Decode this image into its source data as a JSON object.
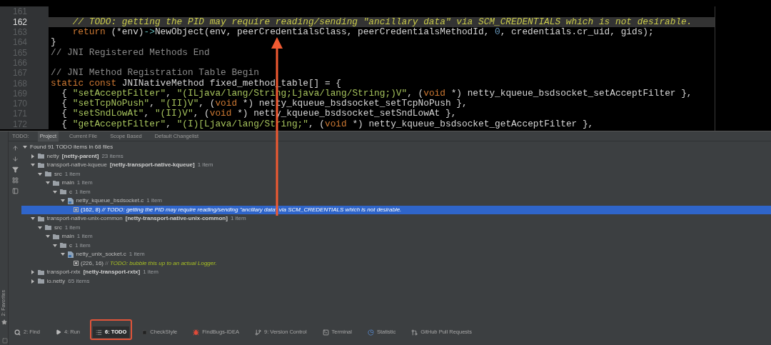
{
  "editor": {
    "lines": [
      {
        "number": "161",
        "current": false
      },
      {
        "number": "162",
        "current": true,
        "indented": true,
        "segments": [
          {
            "kind": "todo",
            "text": "// TODO: getting the PID may require reading/sending \"ancillary data\" via SCM_CREDENTIALS which is not desirable."
          }
        ]
      },
      {
        "number": "163",
        "current": false,
        "indented": true,
        "segments": [
          {
            "kind": "keyword",
            "text": "return"
          },
          {
            "kind": "plain",
            "text": " (*env)"
          },
          {
            "kind": "operator",
            "text": "->"
          },
          {
            "kind": "plain",
            "text": "NewObject(env, peerCredentialsClass, peerCredentialsMethodId, "
          },
          {
            "kind": "number",
            "text": "0"
          },
          {
            "kind": "plain",
            "text": ", credentials.cr_uid, gids);"
          }
        ]
      },
      {
        "number": "164",
        "current": false,
        "segments": [
          {
            "kind": "plain",
            "text": "}"
          }
        ]
      },
      {
        "number": "165",
        "current": false,
        "segments": [
          {
            "kind": "comment",
            "text": "// JNI Registered Methods End"
          }
        ]
      },
      {
        "number": "166",
        "current": false
      },
      {
        "number": "167",
        "current": false,
        "segments": [
          {
            "kind": "comment",
            "text": "// JNI Method Registration Table Begin"
          }
        ]
      },
      {
        "number": "168",
        "current": false,
        "segments": [
          {
            "kind": "keyword",
            "text": "static const"
          },
          {
            "kind": "plain",
            "text": " JNINativeMethod fixed_method_table[] = {"
          }
        ]
      },
      {
        "number": "169",
        "current": false,
        "segments": [
          {
            "kind": "plain",
            "text": "  { "
          },
          {
            "kind": "string",
            "text": "\"setAcceptFilter\""
          },
          {
            "kind": "plain",
            "text": ", "
          },
          {
            "kind": "string",
            "text": "\"(ILjava/lang/String;Ljava/lang/String;)V\""
          },
          {
            "kind": "plain",
            "text": ", ("
          },
          {
            "kind": "keyword",
            "text": "void"
          },
          {
            "kind": "plain",
            "text": " *) netty_kqueue_bsdsocket_setAcceptFilter },"
          }
        ]
      },
      {
        "number": "170",
        "current": false,
        "segments": [
          {
            "kind": "plain",
            "text": "  { "
          },
          {
            "kind": "string",
            "text": "\"setTcpNoPush\""
          },
          {
            "kind": "plain",
            "text": ", "
          },
          {
            "kind": "string",
            "text": "\"(II)V\""
          },
          {
            "kind": "plain",
            "text": ", ("
          },
          {
            "kind": "keyword",
            "text": "void"
          },
          {
            "kind": "plain",
            "text": " *) netty_kqueue_bsdsocket_setTcpNoPush },"
          }
        ]
      },
      {
        "number": "171",
        "current": false,
        "segments": [
          {
            "kind": "plain",
            "text": "  { "
          },
          {
            "kind": "string",
            "text": "\"setSndLowAt\""
          },
          {
            "kind": "plain",
            "text": ", "
          },
          {
            "kind": "string",
            "text": "\"(II)V\""
          },
          {
            "kind": "plain",
            "text": ", ("
          },
          {
            "kind": "keyword",
            "text": "void"
          },
          {
            "kind": "plain",
            "text": " *) netty_kqueue_bsdsocket_setSndLowAt },"
          }
        ]
      },
      {
        "number": "172",
        "current": false,
        "segments": [
          {
            "kind": "plain",
            "text": "  { "
          },
          {
            "kind": "string",
            "text": "\"getAcceptFilter\""
          },
          {
            "kind": "plain",
            "text": ", "
          },
          {
            "kind": "string",
            "text": "\"(I)[Ljava/lang/String;\""
          },
          {
            "kind": "plain",
            "text": ", ("
          },
          {
            "kind": "keyword",
            "text": "void"
          },
          {
            "kind": "plain",
            "text": " *) netty_kqueue_bsdsocket_getAcceptFilter },"
          }
        ]
      }
    ]
  },
  "todo_panel": {
    "label": "TODO:",
    "tabs": [
      {
        "label": "Project",
        "selected": true
      },
      {
        "label": "Current File",
        "selected": false
      },
      {
        "label": "Scope Based",
        "selected": false
      },
      {
        "label": "Default Changelist",
        "selected": false
      }
    ],
    "tree": [
      {
        "kind": "root",
        "name": "Found 91 TODO items in 68 files",
        "expanded": true,
        "children": [
          {
            "kind": "folder",
            "name": "netty",
            "module": "[netty-parent]",
            "count": "23 items",
            "expanded": false
          },
          {
            "kind": "folder",
            "name": "transport-native-kqueue",
            "module": "[netty-transport-native-kqueue]",
            "count": "1 item",
            "expanded": true,
            "children": [
              {
                "kind": "folder",
                "name": "src",
                "count": "1 item",
                "expanded": true,
                "children": [
                  {
                    "kind": "folder",
                    "name": "main",
                    "count": "1 item",
                    "expanded": true,
                    "children": [
                      {
                        "kind": "folder",
                        "name": "c",
                        "count": "1 item",
                        "expanded": true,
                        "children": [
                          {
                            "kind": "file",
                            "name": "netty_kqueue_bsdsocket.c",
                            "count": "1 item",
                            "expanded": true,
                            "children": [
                              {
                                "kind": "todo",
                                "location": "(162, 8)",
                                "prefix": "//",
                                "text": "TODO: getting the PID may require reading/sending \"ancillary data\" via SCM_CREDENTIALS which is not desirable.",
                                "selected": true
                              }
                            ]
                          }
                        ]
                      }
                    ]
                  }
                ]
              }
            ]
          },
          {
            "kind": "folder",
            "name": "transport-native-unix-common",
            "module": "[netty-transport-native-unix-common]",
            "count": "1 item",
            "expanded": true,
            "children": [
              {
                "kind": "folder",
                "name": "src",
                "count": "1 item",
                "expanded": true,
                "children": [
                  {
                    "kind": "folder",
                    "name": "main",
                    "count": "1 item",
                    "expanded": true,
                    "children": [
                      {
                        "kind": "folder",
                        "name": "c",
                        "count": "1 item",
                        "expanded": true,
                        "children": [
                          {
                            "kind": "file",
                            "name": "netty_unix_socket.c",
                            "count": "1 item",
                            "expanded": true,
                            "children": [
                              {
                                "kind": "todo",
                                "location": "(226, 16)",
                                "prefix": "//",
                                "text": "TODO: bubble this up to an actual Logger.",
                                "selected": false
                              }
                            ]
                          }
                        ]
                      }
                    ]
                  }
                ]
              }
            ]
          },
          {
            "kind": "folder",
            "name": "transport-rxtx",
            "module": "[netty-transport-rxtx]",
            "count": "1 item",
            "expanded": false
          },
          {
            "kind": "folder",
            "name": "io.netty",
            "count": "65 items",
            "expanded": false
          }
        ]
      }
    ]
  },
  "favorites": {
    "label": "2: Favorites"
  },
  "tool_windows": [
    {
      "label": "2: Find",
      "selected": false
    },
    {
      "label": "4: Run",
      "selected": false
    },
    {
      "label": "6: TODO",
      "selected": true
    },
    {
      "label": "CheckStyle",
      "selected": false
    },
    {
      "label": "FindBugs-IDEA",
      "selected": false
    },
    {
      "label": "9: Version Control",
      "selected": false
    },
    {
      "label": "Terminal",
      "selected": false
    },
    {
      "label": "Statistic",
      "selected": false
    },
    {
      "label": "GitHub Pull Requests",
      "selected": false
    }
  ]
}
